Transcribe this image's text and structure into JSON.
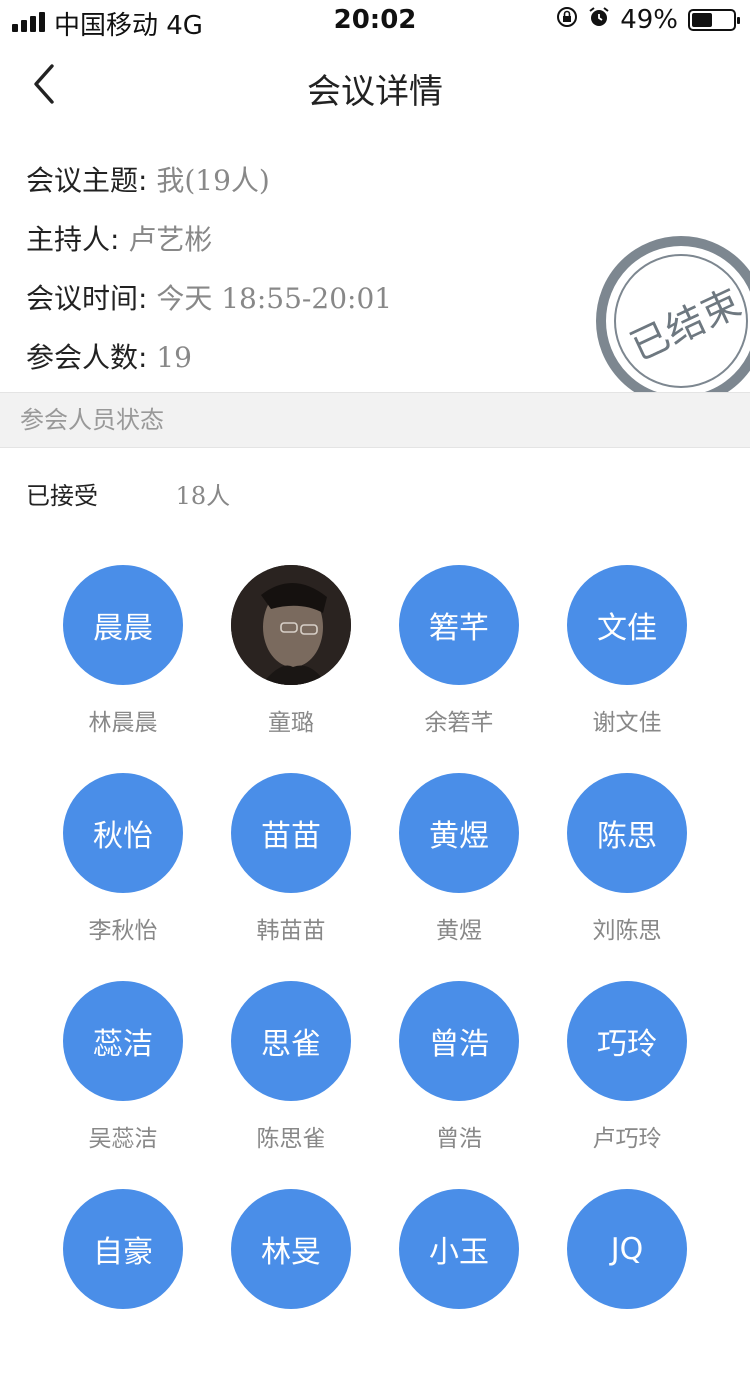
{
  "status_bar": {
    "carrier": "中国移动  4G",
    "time": "20:02",
    "battery": "49%",
    "battery_level": 0.49
  },
  "nav": {
    "title": "会议详情",
    "back_icon": "chevron-left-icon"
  },
  "meeting": {
    "topic_label": "会议主题:",
    "topic_value": "我(19人)",
    "host_label": "主持人:",
    "host_value": "卢艺彬",
    "time_label": "会议时间:",
    "time_value": "今天  18:55-20:01",
    "count_label": "参会人数:",
    "count_value": "19"
  },
  "stamp": {
    "text": "已结束"
  },
  "section_header": "参会人员状态",
  "accepted": {
    "label": "已接受",
    "count": "18人"
  },
  "participants": [
    {
      "avatar_text": "晨晨",
      "name": "林晨晨"
    },
    {
      "avatar_text": "",
      "name": "童璐",
      "photo": true
    },
    {
      "avatar_text": "箬芊",
      "name": "余箬芊"
    },
    {
      "avatar_text": "文佳",
      "name": "谢文佳"
    },
    {
      "avatar_text": "秋怡",
      "name": "李秋怡"
    },
    {
      "avatar_text": "苗苗",
      "name": "韩苗苗"
    },
    {
      "avatar_text": "黄煜",
      "name": "黄煜"
    },
    {
      "avatar_text": "陈思",
      "name": "刘陈思"
    },
    {
      "avatar_text": "蕊洁",
      "name": "吴蕊洁"
    },
    {
      "avatar_text": "思雀",
      "name": "陈思雀"
    },
    {
      "avatar_text": "曾浩",
      "name": "曾浩"
    },
    {
      "avatar_text": "巧玲",
      "name": "卢巧玲"
    },
    {
      "avatar_text": "自豪",
      "name": ""
    },
    {
      "avatar_text": "林旻",
      "name": ""
    },
    {
      "avatar_text": "小玉",
      "name": ""
    },
    {
      "avatar_text": "JQ",
      "name": ""
    }
  ],
  "colors": {
    "avatar_bg": "#4a8ee8",
    "stamp": "#7d8790",
    "section_bg": "#f2f2f2",
    "secondary_text": "#888888"
  }
}
